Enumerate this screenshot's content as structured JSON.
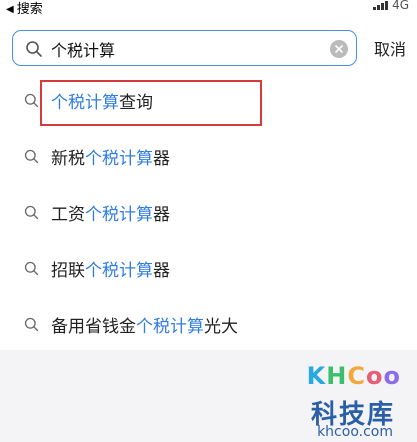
{
  "status_bar": {
    "back_label": "搜索",
    "network": "4G"
  },
  "search": {
    "value": "个税计算",
    "cancel_label": "取消"
  },
  "suggestions": [
    {
      "prefix": "",
      "match": "个税计算",
      "suffix": "查询"
    },
    {
      "prefix": "新税",
      "match": "个税计算",
      "suffix": "器"
    },
    {
      "prefix": "工资",
      "match": "个税计算",
      "suffix": "器"
    },
    {
      "prefix": "招联",
      "match": "个税计算",
      "suffix": "器"
    },
    {
      "prefix": "备用省钱金",
      "match": "个税计算",
      "suffix": "光大"
    }
  ],
  "watermark": {
    "logo_k": "K",
    "logo_h": "H",
    "logo_c": "C",
    "logo_o1": "o",
    "logo_o2": "o",
    "cn_text": "科技库",
    "url": "khcoo.com"
  },
  "colors": {
    "accent": "#2f7de1",
    "search_border": "#4a90e2",
    "highlight_box": "#d63a3a"
  },
  "icons": [
    "search-icon",
    "clear-icon",
    "back-arrow-icon",
    "signal-icon"
  ]
}
